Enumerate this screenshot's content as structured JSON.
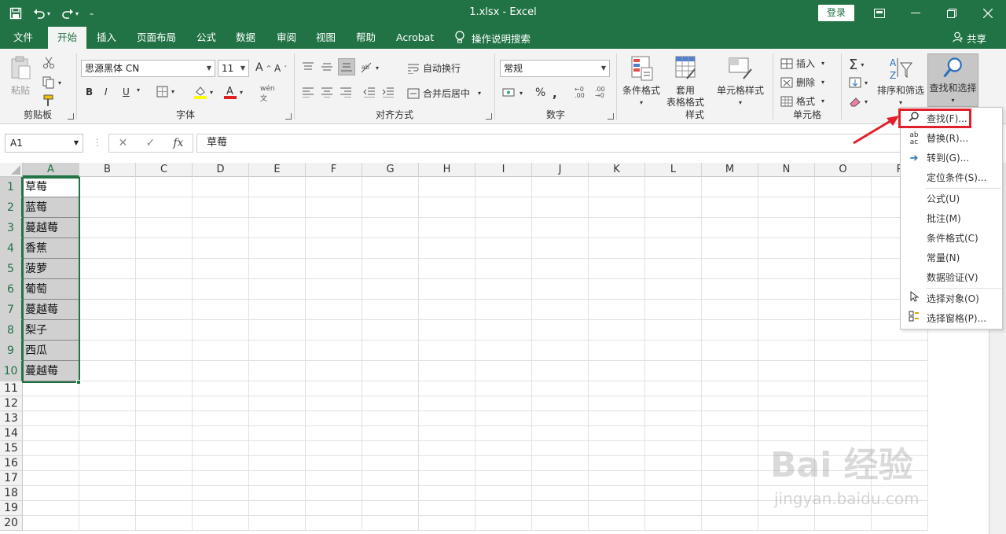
{
  "titlebar": {
    "title": "1.xlsx  -  Excel",
    "login": "登录"
  },
  "tabs": [
    "文件",
    "开始",
    "插入",
    "页面布局",
    "公式",
    "数据",
    "审阅",
    "视图",
    "帮助",
    "Acrobat"
  ],
  "tellme": "操作说明搜索",
  "share": "共享",
  "ribbon": {
    "clipboard": {
      "label": "剪贴板",
      "paste": "粘贴"
    },
    "font": {
      "label": "字体",
      "name": "思源黑体 CN",
      "size": "11",
      "bold": "B",
      "italic": "I",
      "underline": "U"
    },
    "align": {
      "label": "对齐方式",
      "wrap": "自动换行",
      "merge": "合并后居中"
    },
    "number": {
      "label": "数字",
      "format": "常规",
      "percent": "%"
    },
    "styles": {
      "label": "样式",
      "cond": "条件格式",
      "table1": "套用",
      "table2": "表格格式",
      "cell": "单元格样式"
    },
    "cells": {
      "label": "单元格",
      "insert": "插入",
      "delete": "删除",
      "format": "格式"
    },
    "editing": {
      "sort": "排序和筛选",
      "find": "查找和选择"
    }
  },
  "formula": {
    "namebox": "A1",
    "value": "草莓"
  },
  "columns": [
    "A",
    "B",
    "C",
    "D",
    "E",
    "F",
    "G",
    "H",
    "I",
    "J",
    "K",
    "L",
    "M",
    "N",
    "O",
    "P"
  ],
  "rows": [
    "1",
    "2",
    "3",
    "4",
    "5",
    "6",
    "7",
    "8",
    "9",
    "10",
    "11",
    "12",
    "13",
    "14",
    "15",
    "16",
    "17",
    "18",
    "19",
    "20"
  ],
  "cells_a": [
    "草莓",
    "蓝莓",
    "蔓越莓",
    "香蕉",
    "菠萝",
    "葡萄",
    "蔓越莓",
    "梨子",
    "西瓜",
    "蔓越莓"
  ],
  "menu": [
    {
      "label": "查找(F)...",
      "key": "F"
    },
    {
      "label": "替换(R)...",
      "key": "R"
    },
    {
      "label": "转到(G)...",
      "key": "G"
    },
    {
      "label": "定位条件(S)...",
      "key": "S"
    },
    {
      "label": "公式(U)",
      "key": "U"
    },
    {
      "label": "批注(M)",
      "key": "M"
    },
    {
      "label": "条件格式(C)",
      "key": "C"
    },
    {
      "label": "常量(N)",
      "key": "N"
    },
    {
      "label": "数据验证(V)",
      "key": "V"
    },
    {
      "label": "选择对象(O)",
      "key": "O"
    },
    {
      "label": "选择窗格(P)...",
      "key": "P"
    }
  ],
  "watermark": {
    "brand": "Bai 经验",
    "url": "jingyan.baidu.com"
  }
}
